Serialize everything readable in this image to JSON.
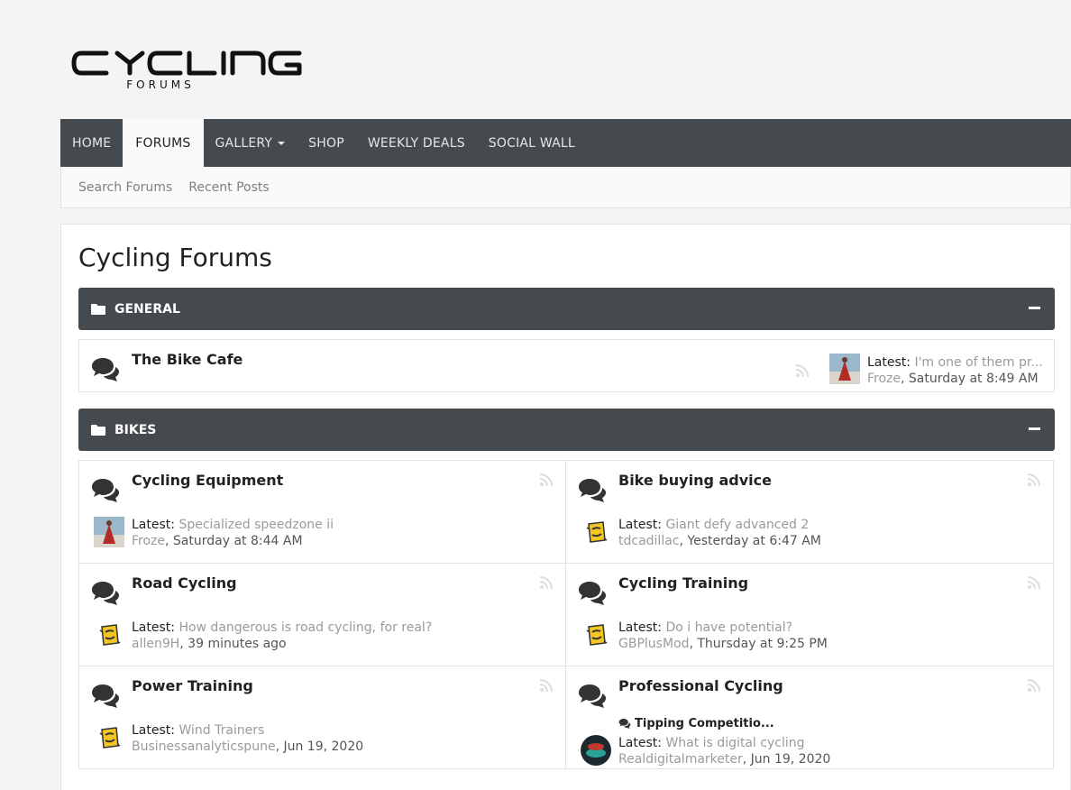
{
  "logo": {
    "text": "CYCLING",
    "sub": "FORUMS"
  },
  "nav": {
    "items": [
      {
        "label": "Home"
      },
      {
        "label": "Forums"
      },
      {
        "label": "Gallery"
      },
      {
        "label": "Shop"
      },
      {
        "label": "Weekly Deals"
      },
      {
        "label": "Social Wall"
      }
    ]
  },
  "subnav": {
    "items": [
      {
        "label": "Search Forums"
      },
      {
        "label": "Recent Posts"
      }
    ]
  },
  "page": {
    "title": "Cycling Forums"
  },
  "categories": [
    {
      "title": "General",
      "nodes": [
        {
          "title": "The Bike Cafe",
          "latest_label": "Latest:",
          "latest_thread": "I'm one of them pr...",
          "latest_user": "Froze",
          "latest_time": ", Saturday at 8:49 AM"
        }
      ]
    },
    {
      "title": "Bikes",
      "nodes": [
        {
          "title": "Cycling Equipment",
          "latest_label": "Latest:",
          "latest_thread": "Specialized speedzone ii",
          "latest_user": "Froze",
          "latest_time": ", Saturday at 8:44 AM"
        },
        {
          "title": "Bike buying advice",
          "latest_label": "Latest:",
          "latest_thread": "Giant defy advanced 2",
          "latest_user": "tdcadillac",
          "latest_time": ", Yesterday at 6:47 AM"
        },
        {
          "title": "Road Cycling",
          "latest_label": "Latest:",
          "latest_thread": "How dangerous is road cycling, for real?",
          "latest_user": "allen9H",
          "latest_time": ", 39 minutes ago"
        },
        {
          "title": "Cycling Training",
          "latest_label": "Latest:",
          "latest_thread": "Do i have potential?",
          "latest_user": "GBPlusMod",
          "latest_time": ", Thursday at 9:25 PM"
        },
        {
          "title": "Power Training",
          "latest_label": "Latest:",
          "latest_thread": "Wind Trainers",
          "latest_user": "Businessanalyticspune",
          "latest_time": ", Jun 19, 2020"
        },
        {
          "title": "Professional Cycling",
          "subforum": "Tipping Competitio...",
          "latest_label": "Latest:",
          "latest_thread": "What is digital cycling",
          "latest_user": "Realdigitalmarketer",
          "latest_time": ", Jun 19, 2020"
        }
      ]
    }
  ],
  "colors": {
    "nav_bg": "#454a4e",
    "link_muted": "#9a9a9a",
    "page_bg": "#f4f4f4"
  }
}
